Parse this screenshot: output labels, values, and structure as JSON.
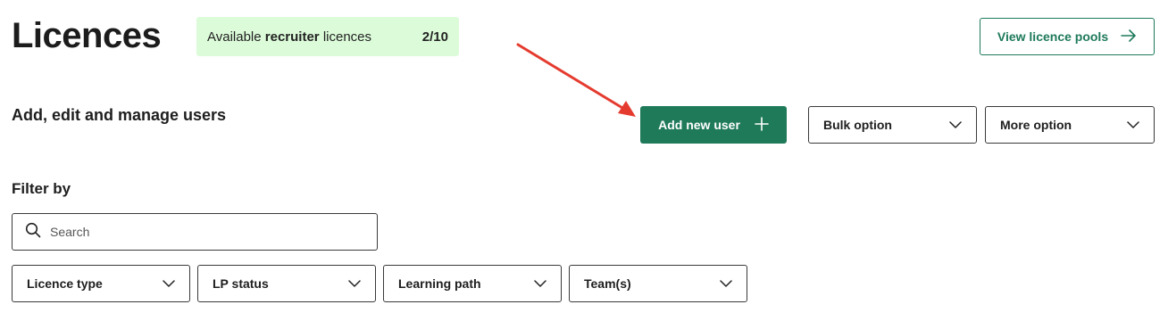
{
  "header": {
    "title": "Licences",
    "licence_badge": {
      "lead": "Available ",
      "strong": "recruiter",
      "tail": " licences",
      "count": "2/10"
    },
    "view_pools_label": "View licence pools"
  },
  "users_section": {
    "title": "Add, edit and manage users",
    "add_user_label": "Add new user",
    "bulk_option_label": "Bulk option",
    "more_option_label": "More option"
  },
  "filters": {
    "title": "Filter by",
    "search_placeholder": "Search",
    "dropdowns": [
      {
        "label": "Licence type"
      },
      {
        "label": "LP status"
      },
      {
        "label": "Learning path"
      },
      {
        "label": "Team(s)"
      }
    ]
  },
  "colors": {
    "accent": "#1f7a5a",
    "badge_bg": "#dcfcd9",
    "annotation": "#e53b2f"
  },
  "icons": {
    "view_pools": "arrow-right-icon",
    "add_user": "plus-icon",
    "dropdown": "chevron-down-icon",
    "search": "search-icon"
  }
}
